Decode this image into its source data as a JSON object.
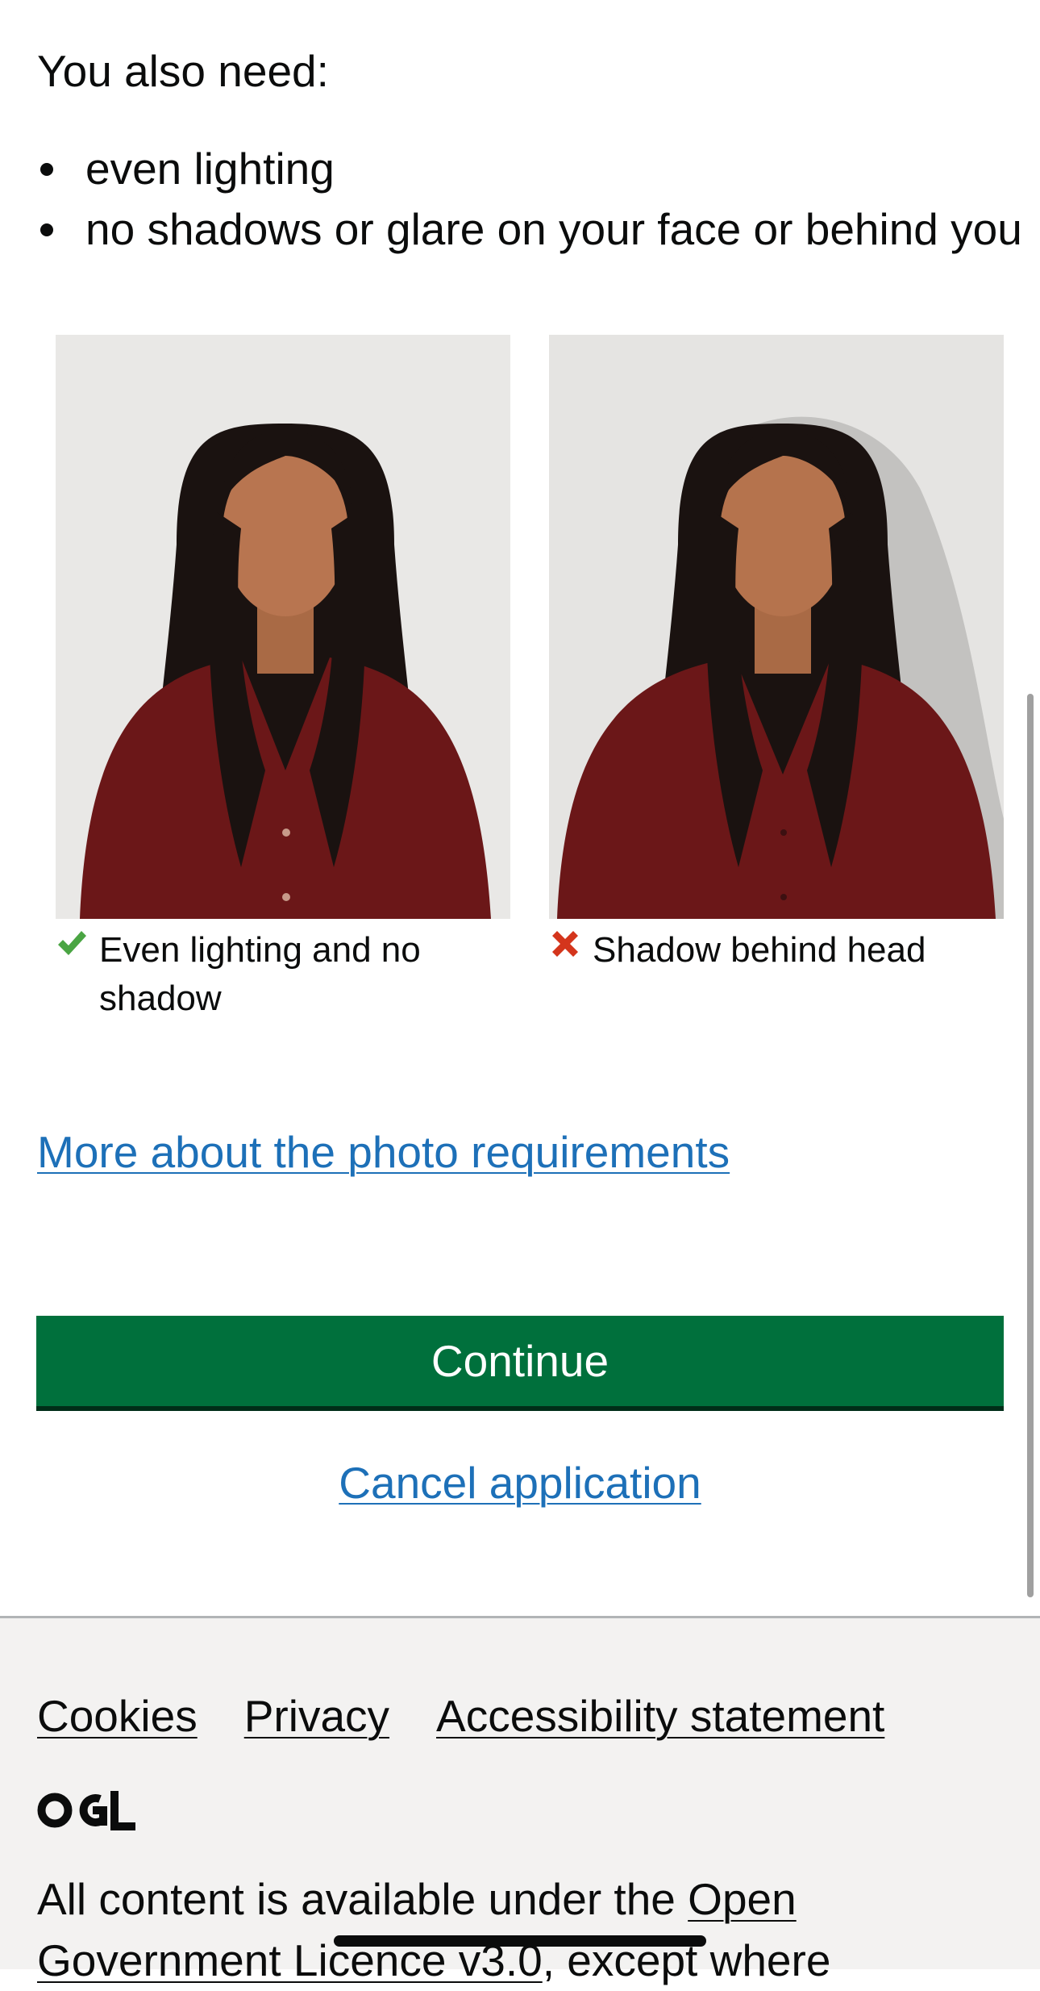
{
  "intro": "You also need:",
  "requirements": [
    "even lighting",
    "no shadows or glare on your face or behind you"
  ],
  "examples": {
    "good": {
      "caption": "Even lighting and no shadow",
      "status_icon": "check-icon",
      "status_color": "#4aa543"
    },
    "bad": {
      "caption": "Shadow behind head",
      "status_icon": "cross-icon",
      "status_color": "#d4351c"
    }
  },
  "more_link": "More about the photo requirements",
  "continue_label": "Continue",
  "cancel_label": "Cancel application",
  "footer": {
    "links": [
      "Cookies",
      "Privacy",
      "Accessibility statement"
    ],
    "logo_text": "OGL",
    "licence_prefix": "All content is available under the ",
    "licence_link": "Open Government Licence v3.0",
    "licence_suffix": ", except where"
  },
  "colors": {
    "link": "#1d70b8",
    "button": "#00703c",
    "footer_bg": "#f3f2f1"
  }
}
